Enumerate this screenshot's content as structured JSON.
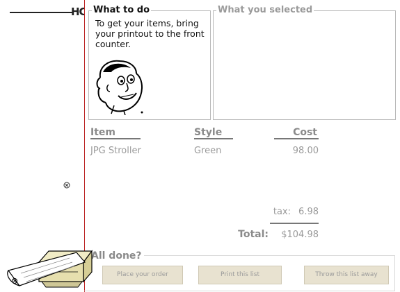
{
  "left_strip": {
    "clipped_text": "HC"
  },
  "what_to_do": {
    "legend": "What to do",
    "instructions": "To get your items, bring your printout to the front counter."
  },
  "what_you_selected": {
    "legend": "What you selected"
  },
  "table": {
    "headers": {
      "item": "Item",
      "style": "Style",
      "cost": "Cost"
    },
    "rows": [
      {
        "item": "JPG Stroller",
        "style": "Green",
        "cost": "98.00"
      }
    ],
    "tax_label": "tax:",
    "tax_value": "6.98",
    "total_label": "Total:",
    "total_value": "$104.98"
  },
  "all_done": {
    "legend": "All done?",
    "buttons": {
      "place_order": "Place your order",
      "print_list": "Print this list",
      "throw_away": "Throw this list away"
    }
  },
  "colors": {
    "accent_line": "#b22222",
    "button_bg": "#e8e2d0",
    "printer_body": "#e6dfae"
  },
  "icons": [
    "printer-icon",
    "cartoon-face-icon",
    "circle-x-icon"
  ]
}
